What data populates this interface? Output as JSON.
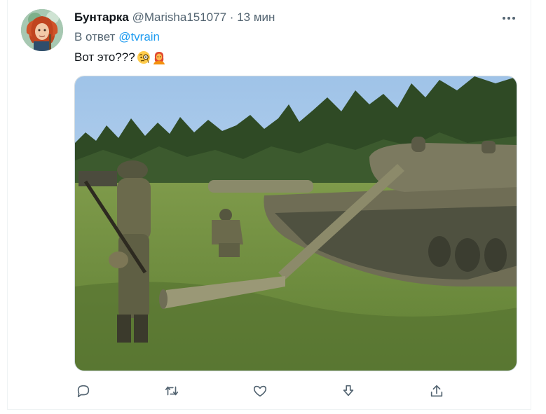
{
  "tweet": {
    "author_name": "Бунтарка",
    "handle": "@Marisha151077",
    "separator": "·",
    "time": "13 мин",
    "reply_prefix": "В ответ",
    "reply_mention": "@tvrain",
    "text": "Вот это???",
    "emojis": [
      "monocle-face-emoji",
      "person-red-hair-emoji"
    ]
  },
  "media": {
    "icon": "photo-inflatable-tank-soldiers"
  },
  "actions": [
    {
      "name": "reply-icon"
    },
    {
      "name": "retweet-icon"
    },
    {
      "name": "like-icon"
    },
    {
      "name": "download-icon"
    },
    {
      "name": "share-icon"
    }
  ],
  "colors": {
    "accent": "#1d9bf0",
    "secondary_text": "#536471",
    "primary_text": "#0f1419"
  }
}
